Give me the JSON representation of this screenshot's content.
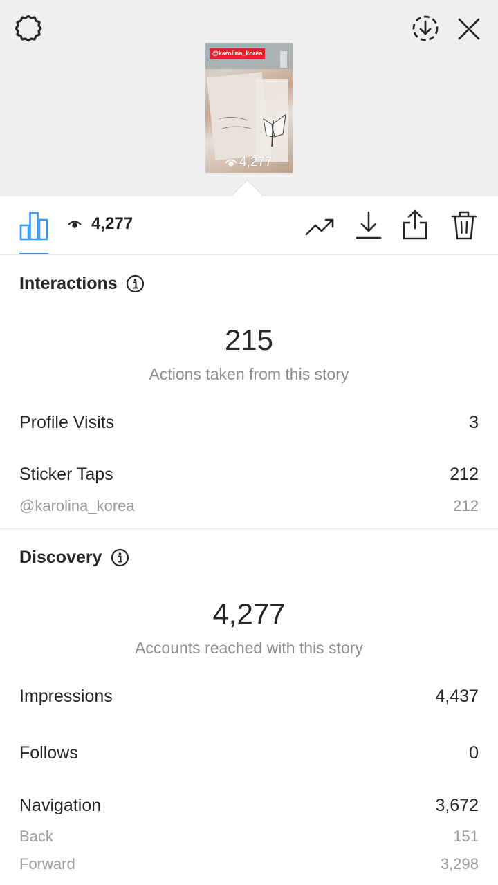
{
  "story": {
    "tag": "@karolina_korea",
    "views": "4,277"
  },
  "toolbar": {
    "views": "4,277"
  },
  "interactions": {
    "title": "Interactions",
    "total": "215",
    "total_label": "Actions taken from this story",
    "rows": [
      {
        "label": "Profile Visits",
        "value": "3"
      },
      {
        "label": "Sticker Taps",
        "value": "212"
      }
    ],
    "sub_rows": [
      {
        "label": "@karolina_korea",
        "value": "212"
      }
    ]
  },
  "discovery": {
    "title": "Discovery",
    "total": "4,277",
    "total_label": "Accounts reached with this story",
    "rows": [
      {
        "label": "Impressions",
        "value": "4,437"
      },
      {
        "label": "Follows",
        "value": "0"
      },
      {
        "label": "Navigation",
        "value": "3,672"
      }
    ],
    "sub_rows": [
      {
        "label": "Back",
        "value": "151"
      },
      {
        "label": "Forward",
        "value": "3,298"
      }
    ]
  },
  "colors": {
    "accent": "#3897f0",
    "header_bg": "#efefef",
    "sticker_red": "#e0212b"
  }
}
